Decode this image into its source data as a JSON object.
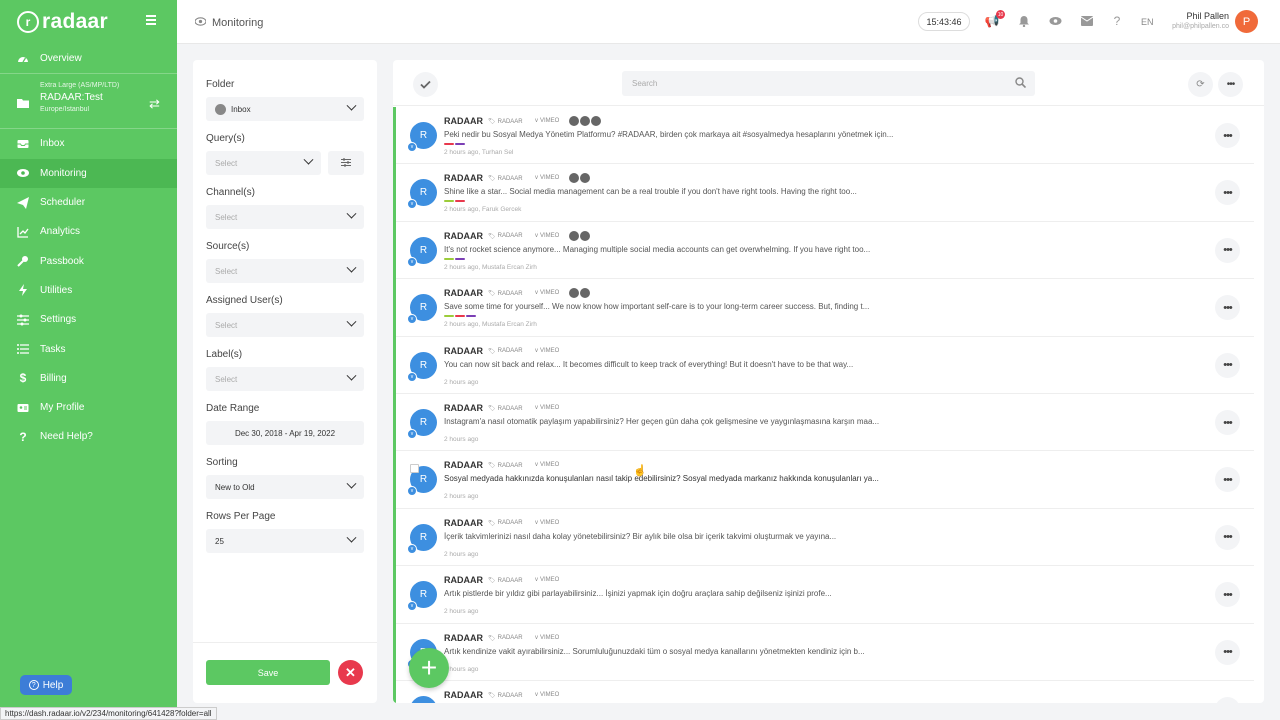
{
  "app": {
    "logo_text": "radaar",
    "url": "https://dash.radaar.io/v2/234/monitoring/641428?folder=all"
  },
  "sidebar": {
    "account": {
      "plan": "Extra Large (AS/MP/LTD)",
      "name": "RADAAR:Test",
      "timezone": "Europe/Istanbul"
    },
    "items": [
      {
        "label": "Overview",
        "icon": "dashboard-icon"
      },
      {
        "label": "Inbox",
        "icon": "inbox-icon"
      },
      {
        "label": "Monitoring",
        "icon": "eye-icon",
        "active": true
      },
      {
        "label": "Scheduler",
        "icon": "paper-plane-icon"
      },
      {
        "label": "Analytics",
        "icon": "chart-icon"
      },
      {
        "label": "Passbook",
        "icon": "key-icon"
      },
      {
        "label": "Utilities",
        "icon": "bolt-icon"
      },
      {
        "label": "Settings",
        "icon": "sliders-icon"
      },
      {
        "label": "Tasks",
        "icon": "list-icon"
      },
      {
        "label": "Billing",
        "icon": "dollar-icon"
      },
      {
        "label": "My Profile",
        "icon": "id-card-icon"
      },
      {
        "label": "Need Help?",
        "icon": "question-icon"
      }
    ],
    "help_label": "Help"
  },
  "topbar": {
    "title": "Monitoring",
    "clock": "15:43:46",
    "badge_count": "10",
    "lang": "EN",
    "user_name": "Phil Pallen",
    "user_email": "phil@philpallen.co",
    "avatar_letter": "P"
  },
  "filters": {
    "folder_label": "Folder",
    "folder_value": "Inbox",
    "query_label": "Query(s)",
    "query_placeholder": "Select",
    "channel_label": "Channel(s)",
    "channel_placeholder": "Select",
    "source_label": "Source(s)",
    "source_placeholder": "Select",
    "assigned_label": "Assigned User(s)",
    "assigned_placeholder": "Select",
    "label_label": "Label(s)",
    "label_placeholder": "Select",
    "date_label": "Date Range",
    "date_value": "Dec 30, 2018 - Apr 19, 2022",
    "sorting_label": "Sorting",
    "sorting_value": "New to Old",
    "rows_label": "Rows Per Page",
    "rows_value": "25",
    "save_label": "Save"
  },
  "main": {
    "search_placeholder": "Search",
    "rows": [
      {
        "source": "RADAAR",
        "tag": "RADAAR",
        "channel": "VIMEO",
        "text": "Peki nedir bu Sosyal Medya Yönetim Platformu? #RADAAR, birden çok markaya ait #sosyalmedya hesaplarını yönetmek için...",
        "meta": "2 hours ago, Turhan Sel",
        "people": 3,
        "colors": [
          "#e8394d",
          "#7b3fb5"
        ]
      },
      {
        "source": "RADAAR",
        "tag": "RADAAR",
        "channel": "VIMEO",
        "text": "Shine like a star... Social media management can be a real trouble if you don't have right tools. Having the right too...",
        "meta": "2 hours ago, Faruk Gercek",
        "people": 2,
        "colors": [
          "#9ccc3a",
          "#e8394d"
        ]
      },
      {
        "source": "RADAAR",
        "tag": "RADAAR",
        "channel": "VIMEO",
        "text": "It's not rocket science anymore... Managing multiple social media accounts can get overwhelming. If you have right too...",
        "meta": "2 hours ago, Mustafa Ercan Zirh",
        "people": 2,
        "colors": [
          "#9ccc3a",
          "#7b3fb5"
        ]
      },
      {
        "source": "RADAAR",
        "tag": "RADAAR",
        "channel": "VIMEO",
        "text": "Save some time for yourself... We now know how important self-care is to your long-term career success. But, finding t...",
        "meta": "2 hours ago, Mustafa Ercan Zirh",
        "people": 2,
        "colors": [
          "#9ccc3a",
          "#e8394d",
          "#7b3fb5"
        ]
      },
      {
        "source": "RADAAR",
        "tag": "RADAAR",
        "channel": "VIMEO",
        "text": "You can now sit back and relax... It becomes difficult to keep track of everything! But it doesn't have to be that way...",
        "meta": "2 hours ago",
        "people": 0,
        "colors": []
      },
      {
        "source": "RADAAR",
        "tag": "RADAAR",
        "channel": "VIMEO",
        "text": "Instagram'a nasıl otomatik paylaşım yapabilirsiniz? Her geçen gün daha çok gelişmesine ve yaygınlaşmasına karşın maa...",
        "meta": "2 hours ago",
        "people": 0,
        "colors": []
      },
      {
        "source": "RADAAR",
        "tag": "RADAAR",
        "channel": "VIMEO",
        "text": "Sosyal medyada hakkınızda konuşulanları nasıl takip edebilirsiniz? Sosyal medyada markanız hakkında konuşulanları ya...",
        "meta": "2 hours ago",
        "people": 0,
        "colors": [],
        "dark": true
      },
      {
        "source": "RADAAR",
        "tag": "RADAAR",
        "channel": "VIMEO",
        "text": "İçerik takvimlerinizi nasıl daha kolay yönetebilirsiniz? Bir aylık bile olsa bir içerik takvimi oluşturmak ve yayına...",
        "meta": "2 hours ago",
        "people": 0,
        "colors": []
      },
      {
        "source": "RADAAR",
        "tag": "RADAAR",
        "channel": "VIMEO",
        "text": "Artık pistlerde bir yıldız gibi parlayabilirsiniz... İşinizi yapmak için doğru araçlara sahip değilseniz işinizi profe...",
        "meta": "2 hours ago",
        "people": 0,
        "colors": []
      },
      {
        "source": "RADAAR",
        "tag": "RADAAR",
        "channel": "VIMEO",
        "text": "Artık kendinize vakit ayırabilirsiniz... Sorumluluğunuzdaki tüm o sosyal medya kanallarını yönetmekten kendiniz için b...",
        "meta": "2 hours ago",
        "people": 0,
        "colors": []
      },
      {
        "source": "RADAAR",
        "tag": "RADAAR",
        "channel": "VIMEO",
        "text": "",
        "meta": "",
        "people": 0,
        "colors": []
      }
    ]
  }
}
